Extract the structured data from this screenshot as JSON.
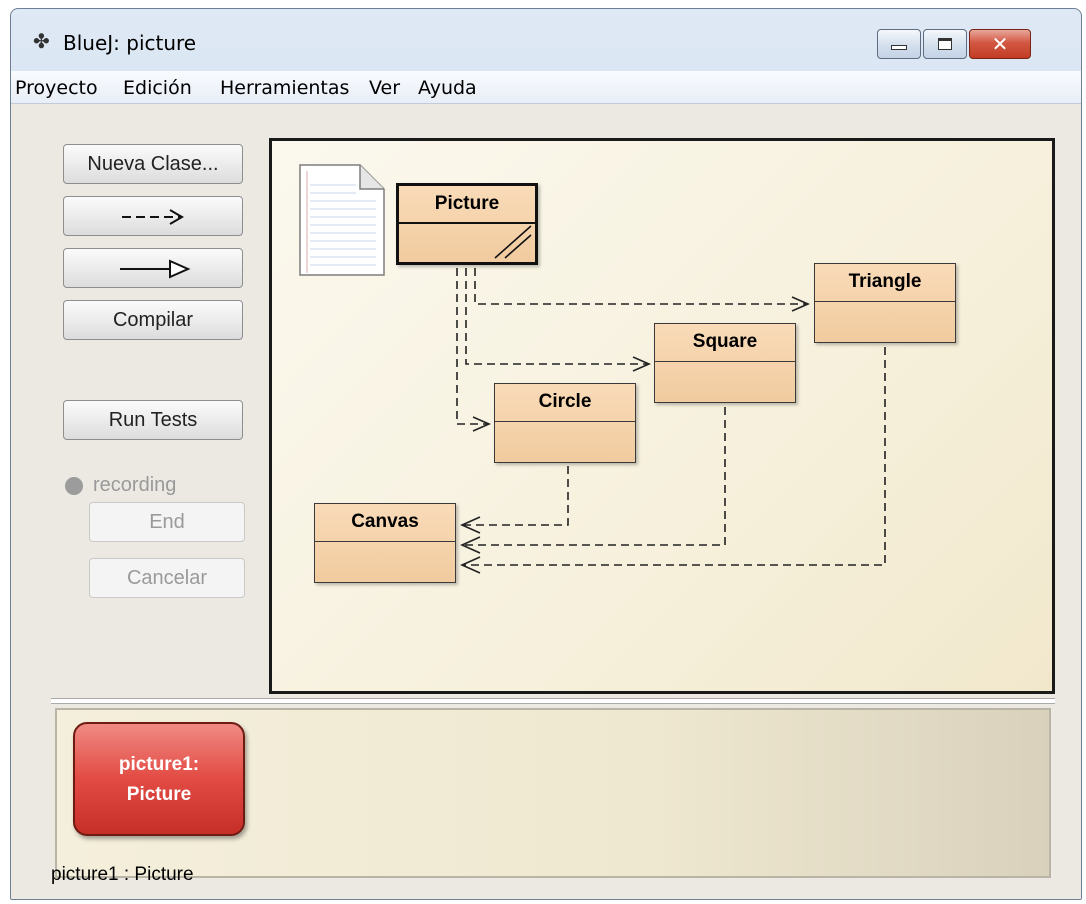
{
  "window": {
    "title": "BlueJ:  picture",
    "app_icon": "bluej-bird-icon",
    "controls": [
      "minimize-icon",
      "maximize-icon",
      "close-icon"
    ]
  },
  "menu": [
    "Proyecto",
    "Edición",
    "Herramientas",
    "Ver",
    "Ayuda"
  ],
  "toolbar": {
    "new_class": "Nueva Clase...",
    "dependency_arrow": "uses-arrow-icon",
    "inheritance_arrow": "inherits-arrow-icon",
    "compile": "Compilar",
    "run_tests": "Run Tests",
    "recording": "recording",
    "end": "End",
    "cancel": "Cancelar"
  },
  "diagram": {
    "readme_icon": "readme-document-icon",
    "classes": [
      {
        "name": "Picture",
        "selected": true
      },
      {
        "name": "Triangle",
        "selected": false
      },
      {
        "name": "Square",
        "selected": false
      },
      {
        "name": "Circle",
        "selected": false
      },
      {
        "name": "Canvas",
        "selected": false
      }
    ],
    "dependencies": [
      {
        "from": "Picture",
        "to": "Triangle"
      },
      {
        "from": "Picture",
        "to": "Square"
      },
      {
        "from": "Picture",
        "to": "Circle"
      },
      {
        "from": "Circle",
        "to": "Canvas"
      },
      {
        "from": "Square",
        "to": "Canvas"
      },
      {
        "from": "Triangle",
        "to": "Canvas"
      }
    ]
  },
  "object_bench": {
    "objects": [
      {
        "name": "picture1:",
        "type": "Picture"
      }
    ]
  },
  "status_bar": "picture1 : Picture",
  "colors": {
    "class_fill": "#f4d1a8",
    "object_fill": "#e0463f",
    "canvas_bg": "#f8f3e2"
  }
}
